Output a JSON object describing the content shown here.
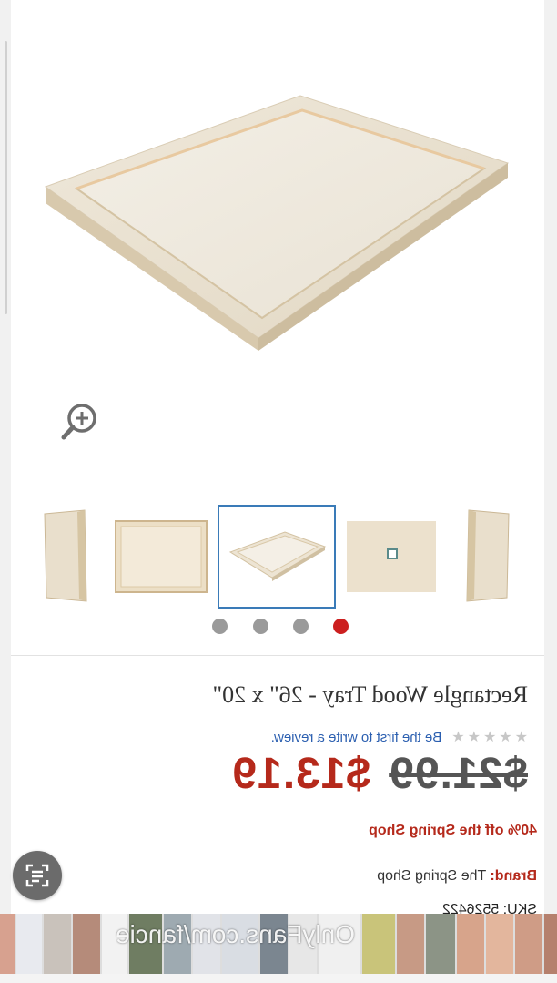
{
  "product": {
    "title": "Rectangle Wood Tray - 26\" x 20\"",
    "review_prompt": "Be the first to write a review.",
    "rating_stars": 0,
    "rating_max": 5,
    "price_original": "$21.99",
    "price_sale": "$13.19",
    "promo": "40% off the Spring Shop",
    "brand_label": "Brand:",
    "brand_value": "The Spring Shop",
    "sku_text": "SKU: 5526422"
  },
  "gallery": {
    "thumbnail_count": 5,
    "selected_thumbnail": 3,
    "dot_count": 4,
    "active_dot": 4
  },
  "overlay": {
    "watermark_text": "OnlyFans.com/fancie"
  },
  "colors": {
    "accent_red": "#b5291b",
    "link_blue": "#2b5fb0",
    "thumb_selected": "#3a7bb8",
    "dot_active": "#cc1f1f",
    "dot_inactive": "#9a9a9a"
  }
}
